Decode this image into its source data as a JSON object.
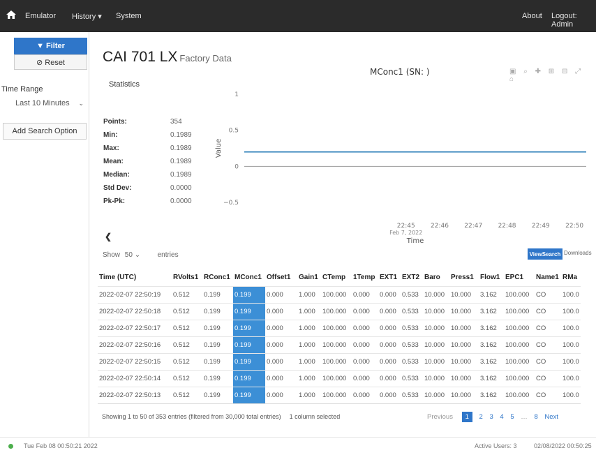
{
  "nav": {
    "items": [
      {
        "label": "Emulator"
      },
      {
        "label": "History ▾"
      },
      {
        "label": "System"
      }
    ],
    "about": "About",
    "logout": "Logout: Admin"
  },
  "sidebar": {
    "filter_label": "▼ Filter",
    "reset_label": "⊘ Reset",
    "time_range_label": "Time Range",
    "time_range_value": "Last 10 Minutes",
    "add_search_label": "Add Search Option"
  },
  "page": {
    "title": "CAI 701 LX",
    "subtitle": "Factory Data"
  },
  "statistics": {
    "title": "Statistics",
    "rows": [
      {
        "k": "Points:",
        "v": "354"
      },
      {
        "k": "Min:",
        "v": "0.1989"
      },
      {
        "k": "Max:",
        "v": "0.1989"
      },
      {
        "k": "Mean:",
        "v": "0.1989"
      },
      {
        "k": "Median:",
        "v": "0.1989"
      },
      {
        "k": "Std Dev:",
        "v": "0.0000"
      },
      {
        "k": "Pk-Pk:",
        "v": "0.0000"
      }
    ]
  },
  "chart": {
    "title": "MConc1 (SN: )",
    "modebar_icons": [
      "camera-icon",
      "zoom-icon",
      "pan-icon",
      "zoom-in-icon",
      "zoom-out-icon",
      "autoscale-icon",
      "reset-axes-icon"
    ]
  },
  "chart_data": {
    "type": "line",
    "xlabel": "Time",
    "ylabel": "Value",
    "ylim": [
      -0.5,
      1
    ],
    "y_ticks": [
      "1",
      "0.5",
      "0",
      "−0.5"
    ],
    "y_tick_values": [
      1,
      0.5,
      0,
      -0.5
    ],
    "x_ticks": [
      "22:45",
      "22:46",
      "22:47",
      "22:48",
      "22:49",
      "22:50"
    ],
    "x_tick_values_minutes": [
      45,
      46,
      47,
      48,
      49,
      50
    ],
    "x_first_tick_sublabel": "Feb 7, 2022",
    "xlim_minutes": [
      40.2,
      50.35
    ],
    "series": [
      {
        "values_constant": 0.199,
        "color": "#1f77b4"
      }
    ],
    "zero_line": true
  },
  "table_controls": {
    "show": "Show",
    "show_value": "50",
    "entries": "entries",
    "viewsearch": "ViewSearch",
    "downloads": "Downloads"
  },
  "table": {
    "columns": [
      "Time (UTC)",
      "RVolts1",
      "RConc1",
      "MConc1",
      "Offset1",
      "Gain1",
      "CTemp",
      "1Temp",
      "EXT1",
      "EXT2",
      "Baro",
      "Press1",
      "Flow1",
      "EPC1",
      "Name1",
      "RMa"
    ],
    "highlight_col": 3,
    "rows": [
      [
        "2022-02-07 22:50:19",
        "0.512",
        "0.199",
        "0.199",
        "0.000",
        "1.000",
        "100.000",
        "0.000",
        "0.000",
        "0.533",
        "10.000",
        "10.000",
        "3.162",
        "100.000",
        "CO",
        "100.0"
      ],
      [
        "2022-02-07 22:50:18",
        "0.512",
        "0.199",
        "0.199",
        "0.000",
        "1.000",
        "100.000",
        "0.000",
        "0.000",
        "0.533",
        "10.000",
        "10.000",
        "3.162",
        "100.000",
        "CO",
        "100.0"
      ],
      [
        "2022-02-07 22:50:17",
        "0.512",
        "0.199",
        "0.199",
        "0.000",
        "1.000",
        "100.000",
        "0.000",
        "0.000",
        "0.533",
        "10.000",
        "10.000",
        "3.162",
        "100.000",
        "CO",
        "100.0"
      ],
      [
        "2022-02-07 22:50:16",
        "0.512",
        "0.199",
        "0.199",
        "0.000",
        "1.000",
        "100.000",
        "0.000",
        "0.000",
        "0.533",
        "10.000",
        "10.000",
        "3.162",
        "100.000",
        "CO",
        "100.0"
      ],
      [
        "2022-02-07 22:50:15",
        "0.512",
        "0.199",
        "0.199",
        "0.000",
        "1.000",
        "100.000",
        "0.000",
        "0.000",
        "0.533",
        "10.000",
        "10.000",
        "3.162",
        "100.000",
        "CO",
        "100.0"
      ],
      [
        "2022-02-07 22:50:14",
        "0.512",
        "0.199",
        "0.199",
        "0.000",
        "1.000",
        "100.000",
        "0.000",
        "0.000",
        "0.533",
        "10.000",
        "10.000",
        "3.162",
        "100.000",
        "CO",
        "100.0"
      ],
      [
        "2022-02-07 22:50:13",
        "0.512",
        "0.199",
        "0.199",
        "0.000",
        "1.000",
        "100.000",
        "0.000",
        "0.000",
        "0.533",
        "10.000",
        "10.000",
        "3.162",
        "100.000",
        "CO",
        "100.0"
      ]
    ],
    "info": "Showing 1 to 50 of 353 entries (filtered from 30,000 total entries)",
    "selection_info": "1 column selected"
  },
  "pagination": {
    "previous": "Previous",
    "pages": [
      "1",
      "2",
      "3",
      "4",
      "5"
    ],
    "ellipsis": "…",
    "last": "8",
    "next": "Next",
    "active": "1"
  },
  "footer": {
    "left_datetime": "Tue Feb 08 00:50:21 2022",
    "active_users": "Active Users: 3",
    "right_datetime": "02/08/2022 00:50:25",
    "status_color": "#4cae4c"
  },
  "colors": {
    "nav_bg": "#2b2b2b",
    "accent": "#2f76c9",
    "highlight_col": "#3c8fd6",
    "series": "#1f77b4"
  }
}
